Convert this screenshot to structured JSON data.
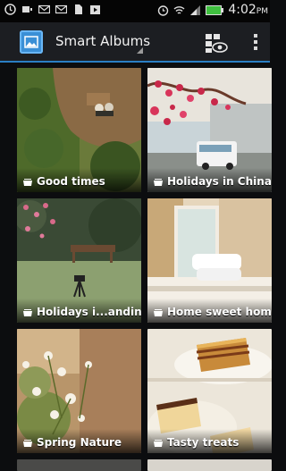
{
  "status_bar": {
    "time": "4:02",
    "time_suffix": "PM",
    "left_icons": [
      "alarm-icon",
      "message-icon",
      "gmail-icon",
      "gmail-icon",
      "sd-card-icon",
      "play-store-icon"
    ],
    "right_icons": [
      "alarm-clock-icon",
      "wifi-icon",
      "signal-icon",
      "battery-icon"
    ]
  },
  "action_bar": {
    "title": "Smart Albums",
    "view_icon": "grid-view-icon",
    "menu_icon": "overflow-menu-icon",
    "accent": "#2b7fc4"
  },
  "albums": [
    {
      "label": "Good times",
      "icon": "album-stack-icon"
    },
    {
      "label": "Holidays in China",
      "icon": "album-stack-icon"
    },
    {
      "label": "Holidays i...andinavia",
      "icon": "album-stack-icon"
    },
    {
      "label": "Home sweet home",
      "icon": "album-stack-icon"
    },
    {
      "label": "Spring Nature",
      "icon": "album-stack-icon"
    },
    {
      "label": "Tasty treats",
      "icon": "album-stack-icon"
    }
  ]
}
